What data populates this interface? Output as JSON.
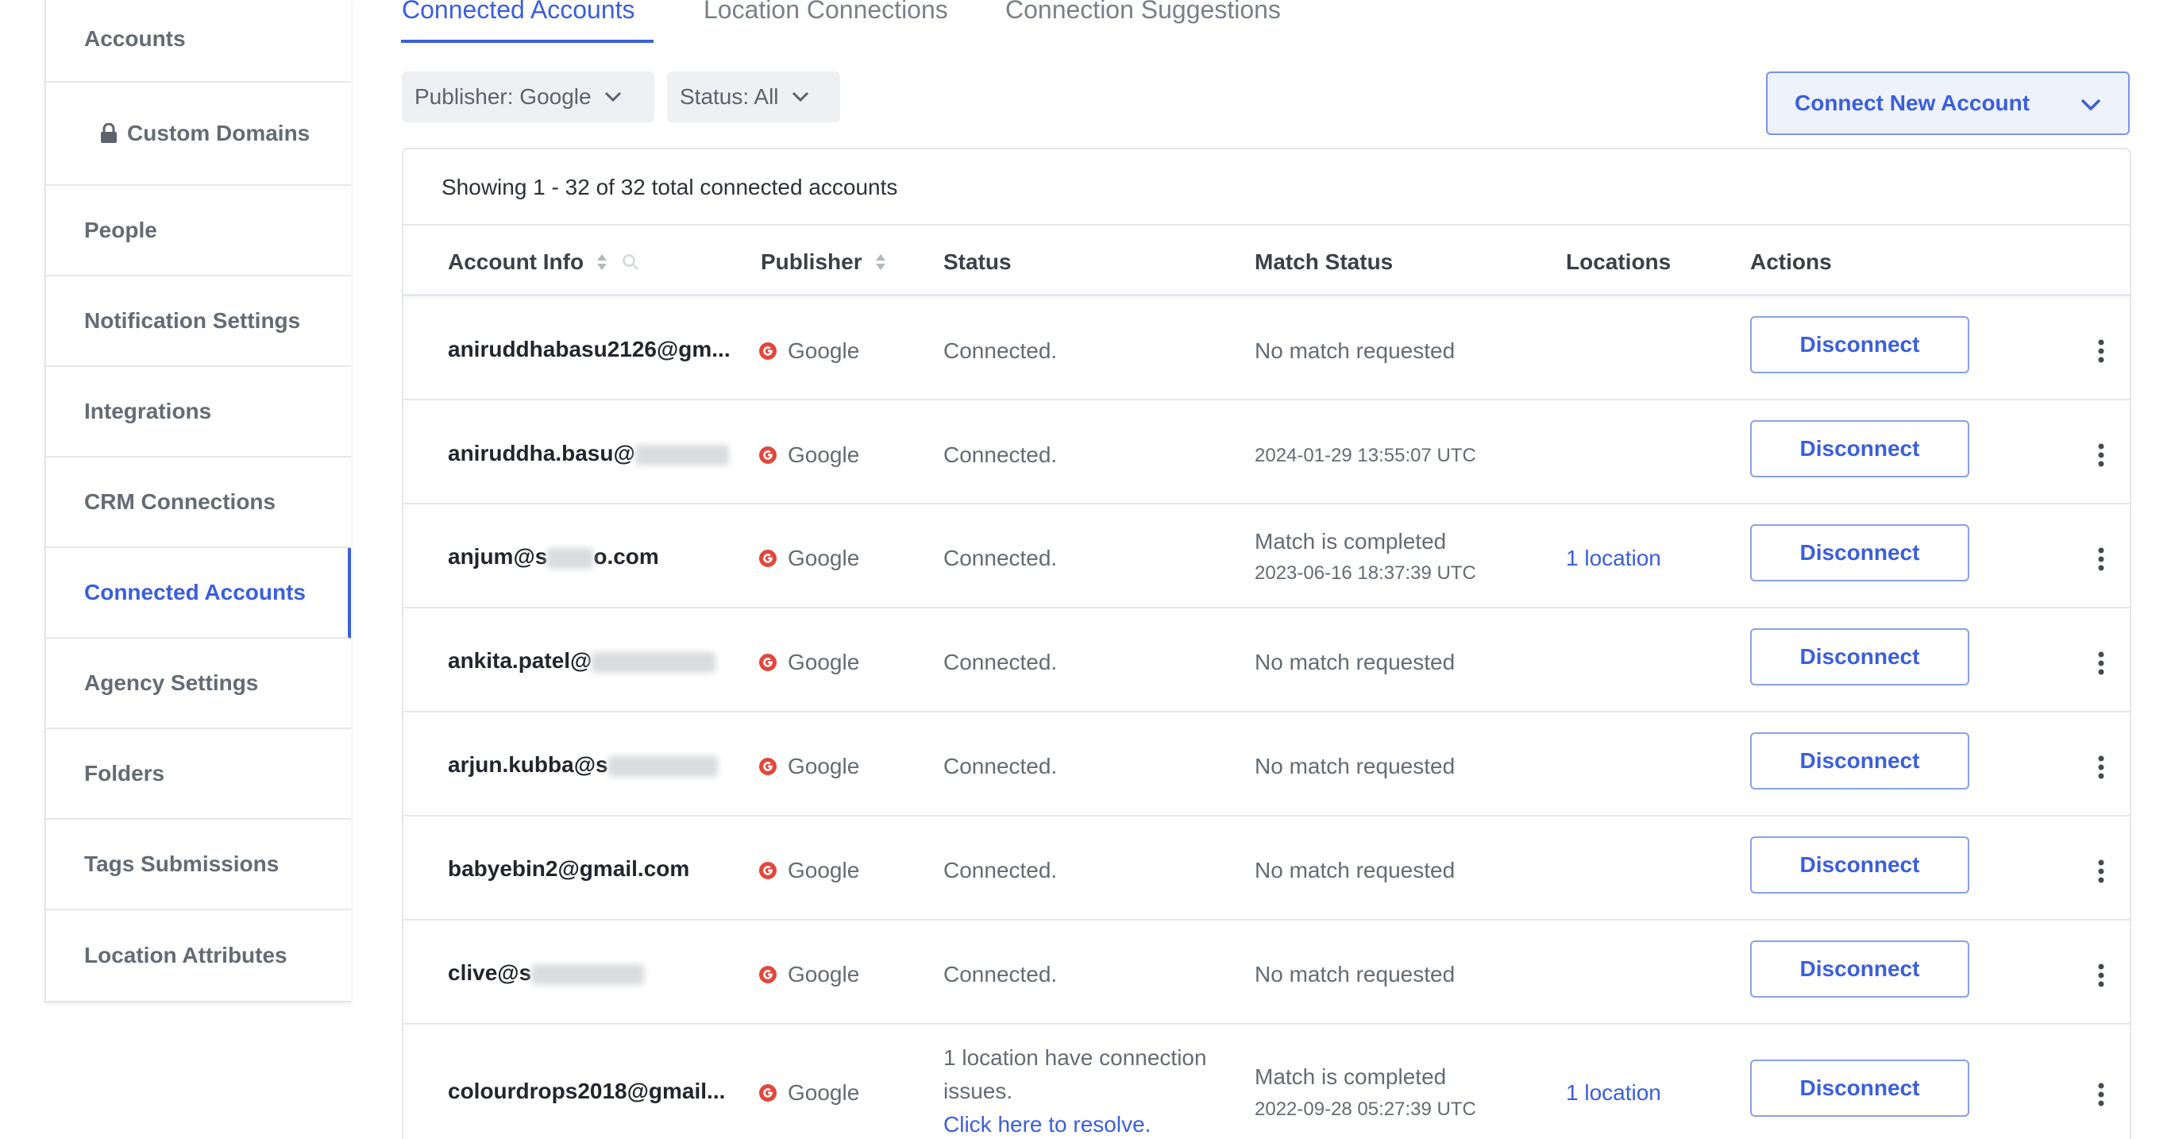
{
  "sidebar": {
    "items": [
      {
        "label": "Accounts"
      },
      {
        "label": "Custom Domains",
        "icon": "lock-icon"
      },
      {
        "label": "People"
      },
      {
        "label": "Notification Settings"
      },
      {
        "label": "Integrations"
      },
      {
        "label": "CRM Connections"
      },
      {
        "label": "Connected Accounts",
        "active": true
      },
      {
        "label": "Agency Settings"
      },
      {
        "label": "Folders"
      },
      {
        "label": "Tags Submissions"
      },
      {
        "label": "Location Attributes"
      }
    ]
  },
  "tabs": [
    {
      "label": "Connected Accounts",
      "active": true
    },
    {
      "label": "Location Connections"
    },
    {
      "label": "Connection Suggestions"
    }
  ],
  "filters": {
    "publisher": "Publisher: Google",
    "status": "Status: All"
  },
  "connect_button": "Connect New Account",
  "table": {
    "showing": "Showing 1 - 32 of 32 total connected accounts",
    "headers": {
      "account": "Account Info",
      "publisher": "Publisher",
      "status": "Status",
      "match": "Match Status",
      "locations": "Locations",
      "actions": "Actions"
    },
    "rows": [
      {
        "account": "aniruddhabasu2126@gm...",
        "publisher": "Google",
        "status": "Connected.",
        "match": "No match requested",
        "match_date": "",
        "locations": "",
        "action": "Disconnect"
      },
      {
        "account": "aniruddha.basu@",
        "publisher": "Google",
        "status": "Connected.",
        "match": "",
        "match_date": "2024-01-29 13:55:07 UTC",
        "locations": "",
        "action": "Disconnect"
      },
      {
        "account_a": "anjum@s",
        "account_b": "o.com",
        "publisher": "Google",
        "status": "Connected.",
        "match": "Match is completed",
        "match_date": "2023-06-16 18:37:39 UTC",
        "locations": "1 location",
        "action": "Disconnect"
      },
      {
        "account": "ankita.patel@",
        "publisher": "Google",
        "status": "Connected.",
        "match": "No match requested",
        "match_date": "",
        "locations": "",
        "action": "Disconnect"
      },
      {
        "account": "arjun.kubba@s",
        "publisher": "Google",
        "status": "Connected.",
        "match": "No match requested",
        "match_date": "",
        "locations": "",
        "action": "Disconnect"
      },
      {
        "account": "babyebin2@gmail.com",
        "publisher": "Google",
        "status": "Connected.",
        "match": "No match requested",
        "match_date": "",
        "locations": "",
        "action": "Disconnect"
      },
      {
        "account": "clive@s",
        "publisher": "Google",
        "status": "Connected.",
        "match": "No match requested",
        "match_date": "",
        "locations": "",
        "action": "Disconnect"
      },
      {
        "account": "colourdrops2018@gmail...",
        "publisher": "Google",
        "status_line1": "1 location have connection",
        "status_line2": "issues.",
        "status_link": "Click here to resolve.",
        "match": "Match is completed",
        "match_date": "2022-09-28 05:27:39 UTC",
        "locations": "1 location",
        "action": "Disconnect"
      }
    ]
  },
  "colors": {
    "accent": "#3a5fd9",
    "google_red": "#e0483d"
  }
}
